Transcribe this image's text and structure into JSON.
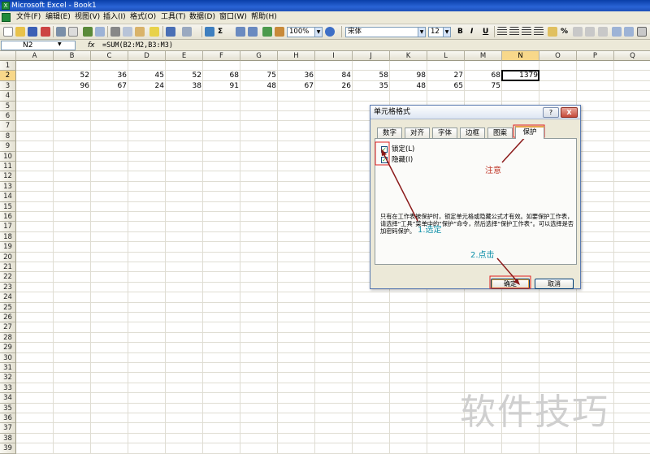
{
  "window": {
    "title": "Microsoft Excel - Book1"
  },
  "menu": [
    "文件(F)",
    "编辑(E)",
    "视图(V)",
    "插入(I)",
    "格式(O)",
    "工具(T)",
    "数据(D)",
    "窗口(W)",
    "帮助(H)"
  ],
  "toolbar": {
    "zoom": "100%",
    "font": "宋体",
    "size": "12",
    "bold": "B",
    "italic": "I",
    "underline": "U",
    "percent": "%"
  },
  "formula_bar": {
    "name_box": "N2",
    "fx": "fx",
    "formula": "=SUM(B2:M2,B3:M3)"
  },
  "sheet": {
    "columns": [
      "A",
      "B",
      "C",
      "D",
      "E",
      "F",
      "G",
      "H",
      "I",
      "J",
      "K",
      "L",
      "M",
      "N",
      "O",
      "P",
      "Q"
    ],
    "active_column": "N",
    "active_row": "2",
    "rows": [
      {
        "row": "2",
        "cells": {
          "B": "52",
          "C": "36",
          "D": "45",
          "E": "52",
          "F": "68",
          "G": "75",
          "H": "36",
          "I": "84",
          "J": "58",
          "K": "98",
          "L": "27",
          "M": "68",
          "N": "1379"
        }
      },
      {
        "row": "3",
        "cells": {
          "B": "96",
          "C": "67",
          "D": "24",
          "E": "38",
          "F": "91",
          "G": "48",
          "H": "67",
          "I": "26",
          "J": "35",
          "K": "48",
          "L": "65",
          "M": "75"
        }
      }
    ]
  },
  "dialog": {
    "title": "单元格格式",
    "help": "?",
    "close": "X",
    "tabs": [
      "数字",
      "对齐",
      "字体",
      "边框",
      "图案",
      "保护"
    ],
    "active_tab": "保护",
    "locked_label": "锁定(L)",
    "locked_checked": true,
    "hidden_label": "隐藏(I)",
    "hidden_checked": true,
    "check_mark": "✓",
    "description": "只有在工作表被保护时，锁定单元格或隐藏公式才有效。如要保护工作表，请选择“工具”菜单中的“保护”命令，然后选择“保护工作表”。可以选择是否加密码保护。",
    "ok": "确定",
    "cancel": "取消"
  },
  "annotations": {
    "note": "注意",
    "step1": "1.选定",
    "step2": "2.点击"
  },
  "watermark": "软件技巧"
}
